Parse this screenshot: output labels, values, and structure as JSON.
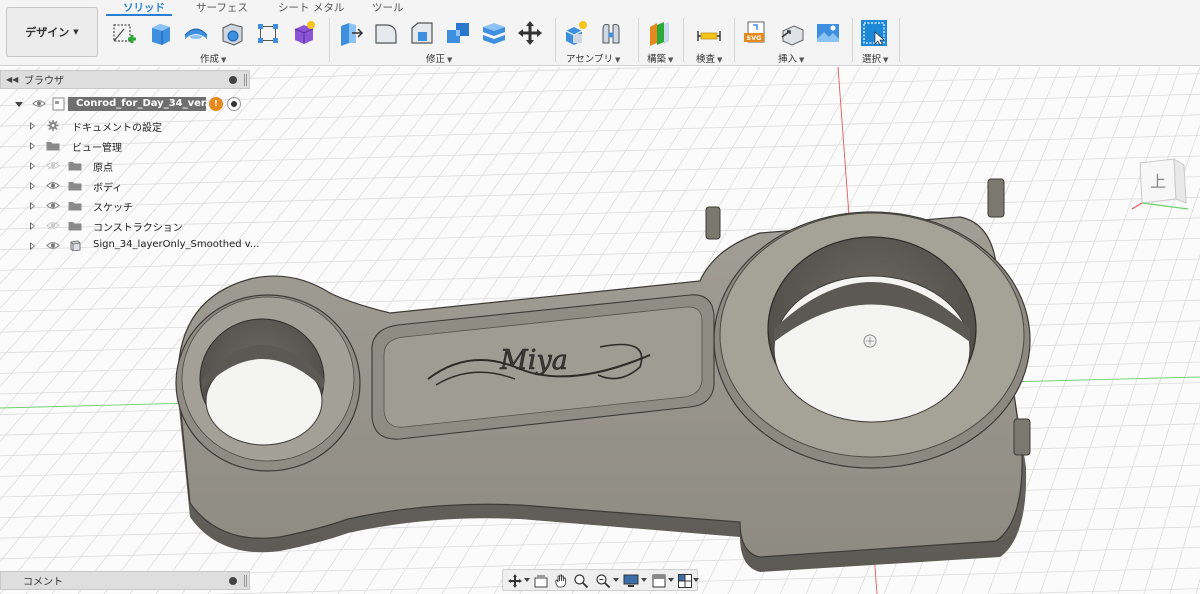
{
  "workspace": {
    "label": "デザイン"
  },
  "tabs": [
    {
      "label": "ソリッド",
      "active": true
    },
    {
      "label": "サーフェス",
      "active": false
    },
    {
      "label": "シート メタル",
      "active": false
    },
    {
      "label": "ツール",
      "active": false
    }
  ],
  "groups": {
    "create": "作成",
    "modify": "修正",
    "assemble": "アセンブリ",
    "construct": "構築",
    "inspect": "検査",
    "insert": "挿入",
    "select": "選択"
  },
  "browser": {
    "title": "ブラウザ",
    "root": {
      "name": "Conrod_for_Day_34_ver..."
    },
    "items": [
      {
        "label": "ドキュメントの設定",
        "icon": "gear-icon",
        "visible": null
      },
      {
        "label": "ビュー管理",
        "icon": "folder-icon",
        "visible": null
      },
      {
        "label": "原点",
        "icon": "folder-icon",
        "visible": false
      },
      {
        "label": "ボディ",
        "icon": "folder-icon",
        "visible": true
      },
      {
        "label": "スケッチ",
        "icon": "folder-icon",
        "visible": true
      },
      {
        "label": "コンストラクション",
        "icon": "folder-icon",
        "visible": false
      },
      {
        "label": "Sign_34_layerOnly_Smoothed v...",
        "icon": "component-icon",
        "visible": true
      }
    ]
  },
  "comments": {
    "title": "コメント"
  },
  "model": {
    "engraving": "Miya"
  },
  "viewcube": {
    "face": "上"
  },
  "colors": {
    "accent": "#2a7fd4",
    "model_fill": "#8d8a81",
    "model_dark": "#5e5b55",
    "grid_line": "#dcdcdc",
    "axis_red": "#e05050",
    "axis_green": "#5cc85c"
  }
}
